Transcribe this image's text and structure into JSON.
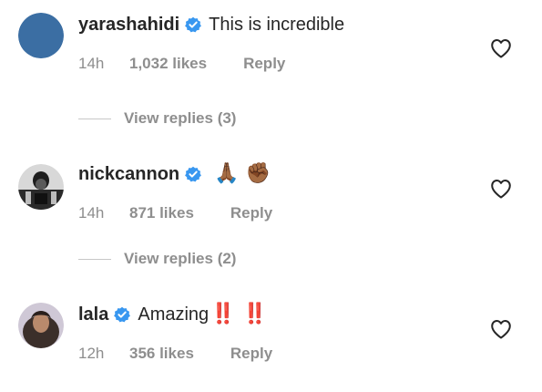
{
  "comments": [
    {
      "username": "yarashahidi",
      "text": "This is incredible",
      "emoji": "",
      "time": "14h",
      "likes": "1,032 likes",
      "reply_label": "Reply",
      "avatar": "blue-circle-avatar",
      "avatar_color": "#3b6ea3"
    },
    {
      "username": "nickcannon",
      "text": "",
      "emoji": "🙏🏾 ✊🏾",
      "time": "14h",
      "likes": "871 likes",
      "reply_label": "Reply",
      "avatar": "photo-avatar-dark"
    },
    {
      "username": "lala",
      "text": "Amazing",
      "emoji": "‼️ ‼️",
      "time": "12h",
      "likes": "356 likes",
      "reply_label": "Reply",
      "avatar": "photo-avatar-woman"
    }
  ],
  "view_replies": [
    {
      "label": "View replies (3)"
    },
    {
      "label": "View replies (2)"
    }
  ],
  "icons": {
    "verified": "verified-badge-icon",
    "like": "heart-outline-icon"
  },
  "colors": {
    "verified_blue": "#3897f0",
    "text_primary": "#262626",
    "text_secondary": "#8e8e8e",
    "divider": "#c7c7c7",
    "emoji_red": "#e03030"
  }
}
